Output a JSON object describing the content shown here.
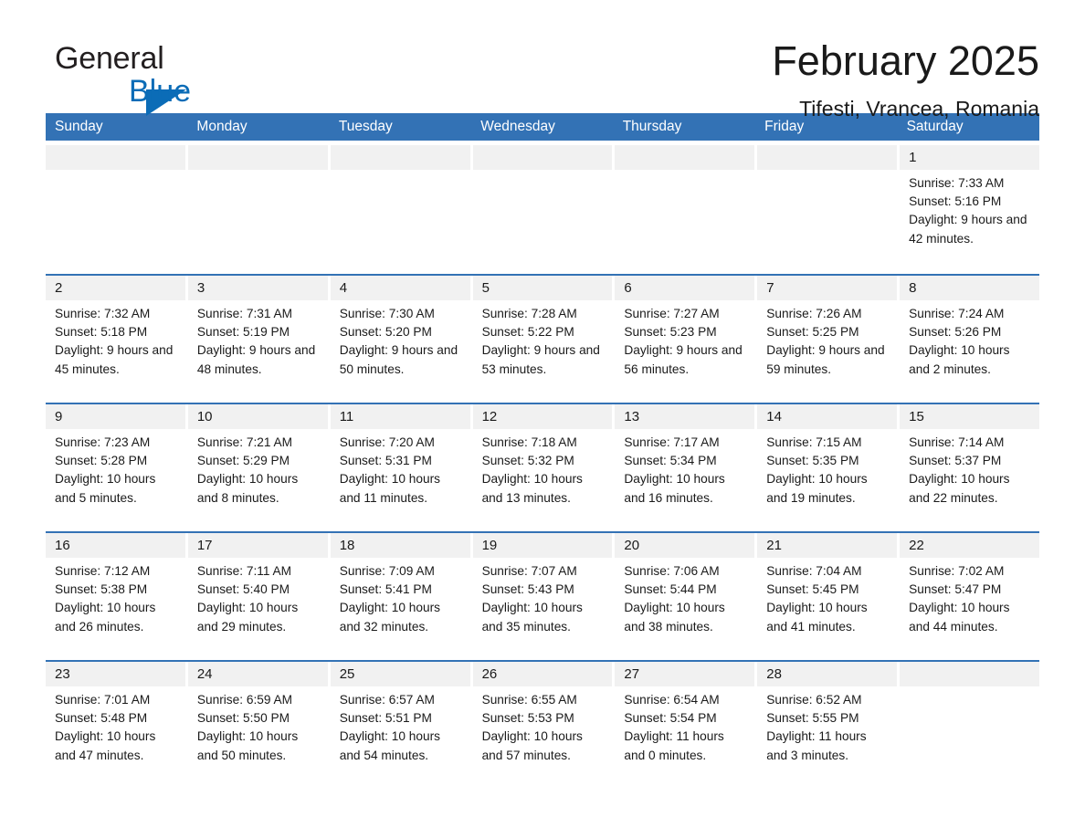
{
  "brand": {
    "name_part1": "General",
    "name_part2": "Blue",
    "triangle_icon": "blue-triangle-icon",
    "accent_color": "#0b6cb7"
  },
  "header": {
    "title": "February 2025",
    "location": "Tifesti, Vrancea, Romania"
  },
  "colors": {
    "header_blue": "#3372b5",
    "row_border_blue": "#3372b5",
    "day_band_gray": "#f1f1f1",
    "text": "#1a1a1a"
  },
  "calendar": {
    "weekdays": [
      "Sunday",
      "Monday",
      "Tuesday",
      "Wednesday",
      "Thursday",
      "Friday",
      "Saturday"
    ],
    "weeks": [
      [
        {
          "date": "",
          "empty": true
        },
        {
          "date": "",
          "empty": true
        },
        {
          "date": "",
          "empty": true
        },
        {
          "date": "",
          "empty": true
        },
        {
          "date": "",
          "empty": true
        },
        {
          "date": "",
          "empty": true
        },
        {
          "date": "1",
          "sunrise": "Sunrise: 7:33 AM",
          "sunset": "Sunset: 5:16 PM",
          "daylight": "Daylight: 9 hours and 42 minutes."
        }
      ],
      [
        {
          "date": "2",
          "sunrise": "Sunrise: 7:32 AM",
          "sunset": "Sunset: 5:18 PM",
          "daylight": "Daylight: 9 hours and 45 minutes."
        },
        {
          "date": "3",
          "sunrise": "Sunrise: 7:31 AM",
          "sunset": "Sunset: 5:19 PM",
          "daylight": "Daylight: 9 hours and 48 minutes."
        },
        {
          "date": "4",
          "sunrise": "Sunrise: 7:30 AM",
          "sunset": "Sunset: 5:20 PM",
          "daylight": "Daylight: 9 hours and 50 minutes."
        },
        {
          "date": "5",
          "sunrise": "Sunrise: 7:28 AM",
          "sunset": "Sunset: 5:22 PM",
          "daylight": "Daylight: 9 hours and 53 minutes."
        },
        {
          "date": "6",
          "sunrise": "Sunrise: 7:27 AM",
          "sunset": "Sunset: 5:23 PM",
          "daylight": "Daylight: 9 hours and 56 minutes."
        },
        {
          "date": "7",
          "sunrise": "Sunrise: 7:26 AM",
          "sunset": "Sunset: 5:25 PM",
          "daylight": "Daylight: 9 hours and 59 minutes."
        },
        {
          "date": "8",
          "sunrise": "Sunrise: 7:24 AM",
          "sunset": "Sunset: 5:26 PM",
          "daylight": "Daylight: 10 hours and 2 minutes."
        }
      ],
      [
        {
          "date": "9",
          "sunrise": "Sunrise: 7:23 AM",
          "sunset": "Sunset: 5:28 PM",
          "daylight": "Daylight: 10 hours and 5 minutes."
        },
        {
          "date": "10",
          "sunrise": "Sunrise: 7:21 AM",
          "sunset": "Sunset: 5:29 PM",
          "daylight": "Daylight: 10 hours and 8 minutes."
        },
        {
          "date": "11",
          "sunrise": "Sunrise: 7:20 AM",
          "sunset": "Sunset: 5:31 PM",
          "daylight": "Daylight: 10 hours and 11 minutes."
        },
        {
          "date": "12",
          "sunrise": "Sunrise: 7:18 AM",
          "sunset": "Sunset: 5:32 PM",
          "daylight": "Daylight: 10 hours and 13 minutes."
        },
        {
          "date": "13",
          "sunrise": "Sunrise: 7:17 AM",
          "sunset": "Sunset: 5:34 PM",
          "daylight": "Daylight: 10 hours and 16 minutes."
        },
        {
          "date": "14",
          "sunrise": "Sunrise: 7:15 AM",
          "sunset": "Sunset: 5:35 PM",
          "daylight": "Daylight: 10 hours and 19 minutes."
        },
        {
          "date": "15",
          "sunrise": "Sunrise: 7:14 AM",
          "sunset": "Sunset: 5:37 PM",
          "daylight": "Daylight: 10 hours and 22 minutes."
        }
      ],
      [
        {
          "date": "16",
          "sunrise": "Sunrise: 7:12 AM",
          "sunset": "Sunset: 5:38 PM",
          "daylight": "Daylight: 10 hours and 26 minutes."
        },
        {
          "date": "17",
          "sunrise": "Sunrise: 7:11 AM",
          "sunset": "Sunset: 5:40 PM",
          "daylight": "Daylight: 10 hours and 29 minutes."
        },
        {
          "date": "18",
          "sunrise": "Sunrise: 7:09 AM",
          "sunset": "Sunset: 5:41 PM",
          "daylight": "Daylight: 10 hours and 32 minutes."
        },
        {
          "date": "19",
          "sunrise": "Sunrise: 7:07 AM",
          "sunset": "Sunset: 5:43 PM",
          "daylight": "Daylight: 10 hours and 35 minutes."
        },
        {
          "date": "20",
          "sunrise": "Sunrise: 7:06 AM",
          "sunset": "Sunset: 5:44 PM",
          "daylight": "Daylight: 10 hours and 38 minutes."
        },
        {
          "date": "21",
          "sunrise": "Sunrise: 7:04 AM",
          "sunset": "Sunset: 5:45 PM",
          "daylight": "Daylight: 10 hours and 41 minutes."
        },
        {
          "date": "22",
          "sunrise": "Sunrise: 7:02 AM",
          "sunset": "Sunset: 5:47 PM",
          "daylight": "Daylight: 10 hours and 44 minutes."
        }
      ],
      [
        {
          "date": "23",
          "sunrise": "Sunrise: 7:01 AM",
          "sunset": "Sunset: 5:48 PM",
          "daylight": "Daylight: 10 hours and 47 minutes."
        },
        {
          "date": "24",
          "sunrise": "Sunrise: 6:59 AM",
          "sunset": "Sunset: 5:50 PM",
          "daylight": "Daylight: 10 hours and 50 minutes."
        },
        {
          "date": "25",
          "sunrise": "Sunrise: 6:57 AM",
          "sunset": "Sunset: 5:51 PM",
          "daylight": "Daylight: 10 hours and 54 minutes."
        },
        {
          "date": "26",
          "sunrise": "Sunrise: 6:55 AM",
          "sunset": "Sunset: 5:53 PM",
          "daylight": "Daylight: 10 hours and 57 minutes."
        },
        {
          "date": "27",
          "sunrise": "Sunrise: 6:54 AM",
          "sunset": "Sunset: 5:54 PM",
          "daylight": "Daylight: 11 hours and 0 minutes."
        },
        {
          "date": "28",
          "sunrise": "Sunrise: 6:52 AM",
          "sunset": "Sunset: 5:55 PM",
          "daylight": "Daylight: 11 hours and 3 minutes."
        },
        {
          "date": "",
          "empty": true
        }
      ]
    ]
  }
}
